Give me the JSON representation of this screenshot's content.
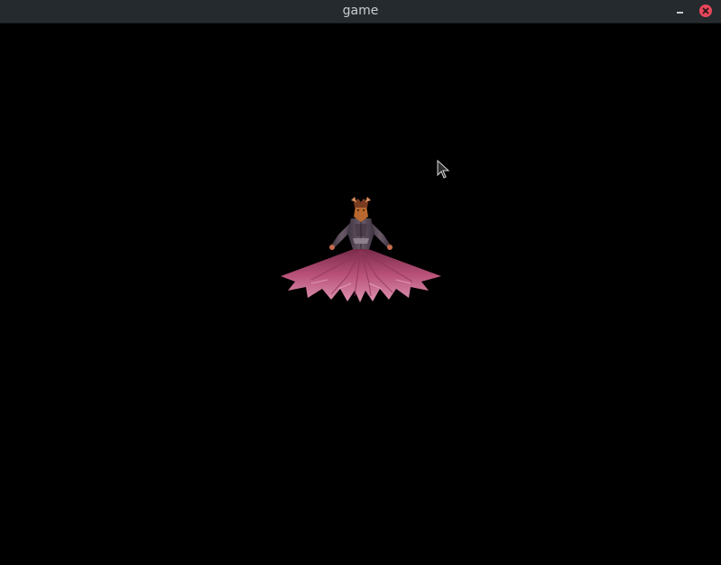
{
  "window": {
    "title": "game"
  },
  "titlebar": {
    "minimize_icon": "minimize-icon",
    "close_icon": "close-icon",
    "close_color": "#e8475b"
  },
  "scene": {
    "background": "#000000",
    "character_description_icon": "character-sprite",
    "cursor_icon": "mouse-pointer-icon"
  }
}
